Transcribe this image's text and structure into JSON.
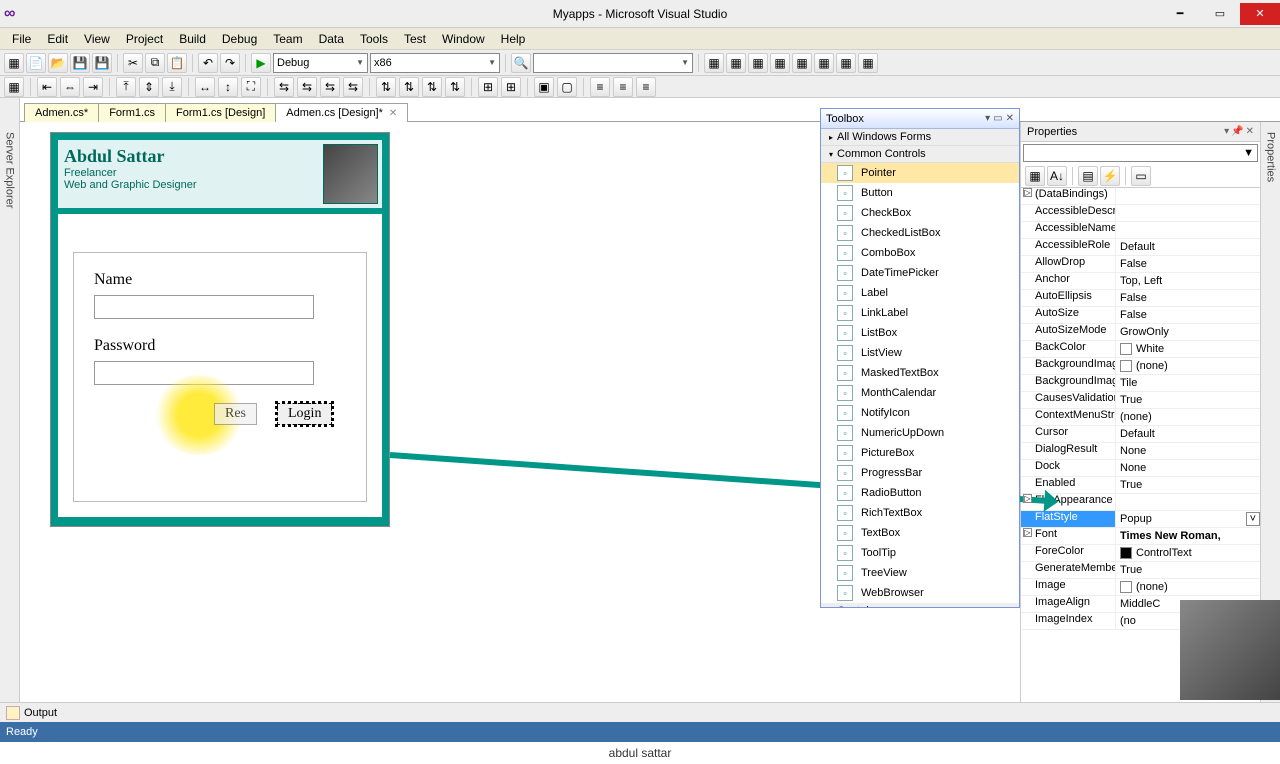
{
  "title": "Myapps - Microsoft Visual Studio",
  "menu": [
    "File",
    "Edit",
    "View",
    "Project",
    "Build",
    "Debug",
    "Team",
    "Data",
    "Tools",
    "Test",
    "Window",
    "Help"
  ],
  "combo_config": "Debug",
  "combo_platform": "x86",
  "tabs": [
    {
      "label": "Admen.cs*",
      "active": false
    },
    {
      "label": "Form1.cs",
      "active": false
    },
    {
      "label": "Form1.cs [Design]",
      "active": false
    },
    {
      "label": "Admen.cs [Design]*",
      "active": true
    }
  ],
  "side_left": "Server Explorer",
  "side_right": "Properties",
  "form": {
    "name": "Abdul Sattar",
    "line2": "Freelancer",
    "line3": "Web and Graphic Designer",
    "label1": "Name",
    "label2": "Password",
    "btn_reset": "Res",
    "btn_login": "Login"
  },
  "toolbox": {
    "title": "Toolbox",
    "groups": [
      {
        "label": "All Windows Forms",
        "expanded": false
      },
      {
        "label": "Common Controls",
        "expanded": true
      }
    ],
    "items": [
      {
        "label": "Pointer",
        "sel": true
      },
      {
        "label": "Button"
      },
      {
        "label": "CheckBox"
      },
      {
        "label": "CheckedListBox"
      },
      {
        "label": "ComboBox"
      },
      {
        "label": "DateTimePicker"
      },
      {
        "label": "Label"
      },
      {
        "label": "LinkLabel"
      },
      {
        "label": "ListBox"
      },
      {
        "label": "ListView"
      },
      {
        "label": "MaskedTextBox"
      },
      {
        "label": "MonthCalendar"
      },
      {
        "label": "NotifyIcon"
      },
      {
        "label": "NumericUpDown"
      },
      {
        "label": "PictureBox"
      },
      {
        "label": "ProgressBar"
      },
      {
        "label": "RadioButton"
      },
      {
        "label": "RichTextBox"
      },
      {
        "label": "TextBox"
      },
      {
        "label": "ToolTip"
      },
      {
        "label": "TreeView"
      },
      {
        "label": "WebBrowser"
      }
    ],
    "group_after": "Containers"
  },
  "properties": {
    "title": "Properties",
    "rows": [
      {
        "k": "(DataBindings)",
        "v": "",
        "exp": true
      },
      {
        "k": "AccessibleDescrip",
        "v": ""
      },
      {
        "k": "AccessibleName",
        "v": ""
      },
      {
        "k": "AccessibleRole",
        "v": "Default"
      },
      {
        "k": "AllowDrop",
        "v": "False"
      },
      {
        "k": "Anchor",
        "v": "Top, Left"
      },
      {
        "k": "AutoEllipsis",
        "v": "False"
      },
      {
        "k": "AutoSize",
        "v": "False"
      },
      {
        "k": "AutoSizeMode",
        "v": "GrowOnly"
      },
      {
        "k": "BackColor",
        "v": "White",
        "swatch": "#ffffff"
      },
      {
        "k": "BackgroundImag",
        "v": "(none)",
        "swatch": ""
      },
      {
        "k": "BackgroundImag",
        "v": "Tile"
      },
      {
        "k": "CausesValidation",
        "v": "True"
      },
      {
        "k": "ContextMenuStrip",
        "v": "(none)"
      },
      {
        "k": "Cursor",
        "v": "Default"
      },
      {
        "k": "DialogResult",
        "v": "None"
      },
      {
        "k": "Dock",
        "v": "None"
      },
      {
        "k": "Enabled",
        "v": "True"
      },
      {
        "k": "FlatAppearance",
        "v": "",
        "exp": true
      },
      {
        "k": "FlatStyle",
        "v": "Popup",
        "sel": true,
        "dd": true
      },
      {
        "k": "Font",
        "v": "Times New Roman,",
        "exp": true,
        "bold": true
      },
      {
        "k": "ForeColor",
        "v": "ControlText",
        "swatch": "#000000"
      },
      {
        "k": "GenerateMember",
        "v": "True"
      },
      {
        "k": "Image",
        "v": "(none)",
        "swatch": ""
      },
      {
        "k": "ImageAlign",
        "v": "MiddleC"
      },
      {
        "k": "ImageIndex",
        "v": "(no"
      }
    ]
  },
  "output_label": "Output",
  "status": "Ready",
  "footer": "abdul sattar"
}
